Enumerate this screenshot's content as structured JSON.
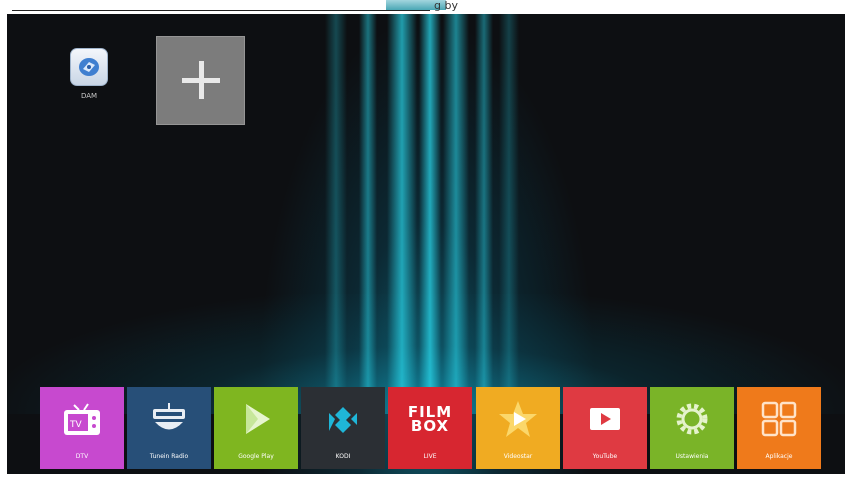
{
  "top_fragment": {
    "left_text": " ",
    "right_text": "g by"
  },
  "desktop": {
    "shortcut_label": "DAM",
    "add_button": "+"
  },
  "dock": [
    {
      "label": "DTV",
      "color": "#c749cf",
      "icon": "tv-icon"
    },
    {
      "label": "Tunein Radio",
      "color": "#274f78",
      "icon": "radio-icon"
    },
    {
      "label": "Google Play",
      "color": "#7fb620",
      "icon": "play-store-icon"
    },
    {
      "label": "KODI",
      "color": "#2b2f34",
      "icon": "kodi-icon"
    },
    {
      "label": "LIVE",
      "color": "#d72630",
      "icon": "filmbox-icon",
      "logo_line1": "FILM",
      "logo_line2": "BOX"
    },
    {
      "label": "Videostar",
      "color": "#f0ab22",
      "icon": "star-play-icon"
    },
    {
      "label": "YouTube",
      "color": "#df3a42",
      "icon": "youtube-icon"
    },
    {
      "label": "Ustawienia",
      "color": "#7ab428",
      "icon": "gear-icon"
    },
    {
      "label": "Aplikacje",
      "color": "#ef7a1b",
      "icon": "apps-grid-icon"
    }
  ],
  "colors": {
    "background": "#0d0f12",
    "glow": "#28d2e6",
    "add_tile": "#7c7c7c"
  }
}
